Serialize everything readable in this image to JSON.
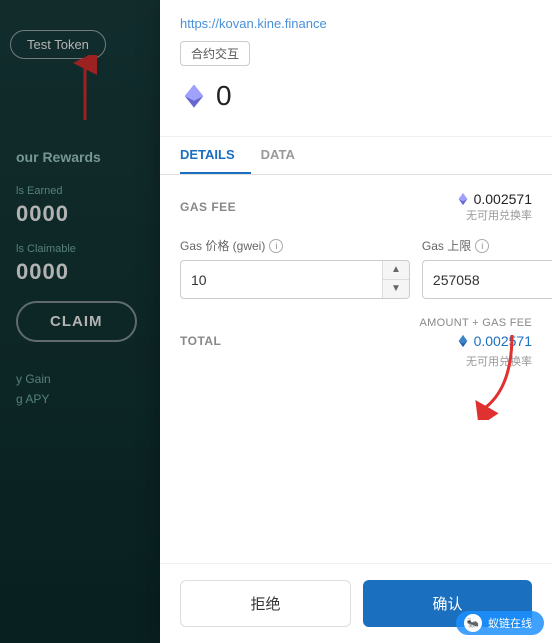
{
  "left_panel": {
    "test_token_label": "Test Token",
    "rewards_title": "our Rewards",
    "earned_label": "ls Earned",
    "earned_value": "0000",
    "claimable_label": "ls Claimable",
    "claimable_value": "0000",
    "claim_button": "CLAIM",
    "gain_label": "y Gain",
    "apy_label": "g APY"
  },
  "modal": {
    "url": "https://kovan.kine.finance",
    "contract_tag": "合约交互",
    "eth_amount": "0",
    "tabs": [
      {
        "label": "DETAILS",
        "active": true
      },
      {
        "label": "DATA",
        "active": false
      }
    ],
    "gas_fee": {
      "label": "GAS FEE",
      "value": "0.002571",
      "note": "无可用兑换率"
    },
    "gas_price": {
      "label": "Gas 价格 (gwei)",
      "value": "10"
    },
    "gas_limit": {
      "label": "Gas 上限",
      "value": "257058"
    },
    "total": {
      "amount_gas_label": "AMOUNT + GAS FEE",
      "label": "TOTAL",
      "value": "0.002571",
      "note": "无可用兑换率"
    },
    "reject_button": "拒绝",
    "confirm_button": "确认"
  },
  "watermark": {
    "text": "蚁链在线"
  },
  "colors": {
    "accent_blue": "#1a6fbf",
    "left_bg": "#1a4040",
    "eth_color": "#7b7bff"
  }
}
